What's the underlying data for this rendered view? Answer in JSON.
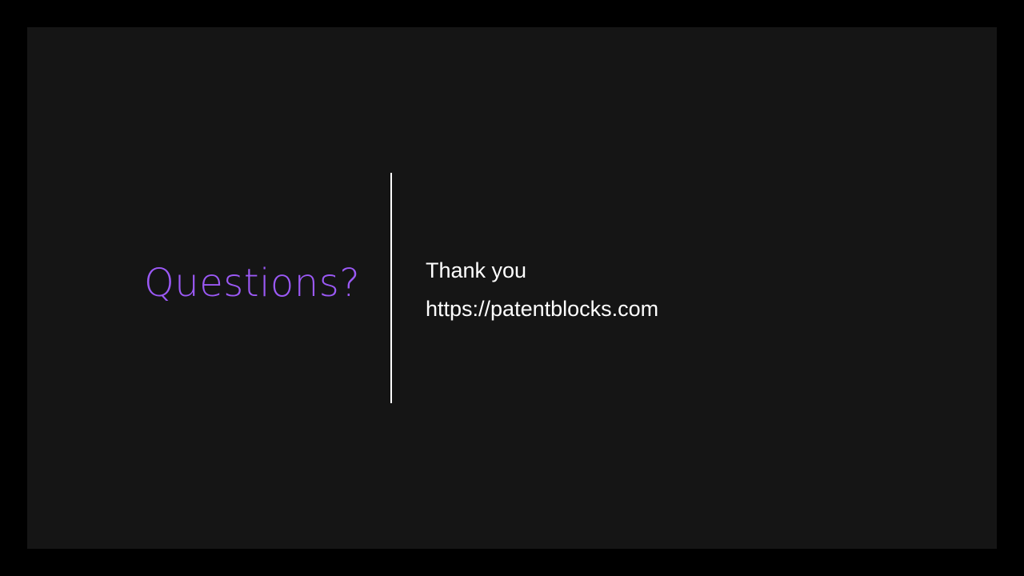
{
  "slide": {
    "heading": "Questions?",
    "lines": [
      "Thank you",
      "https://patentblocks.com"
    ]
  },
  "colors": {
    "outer_background": "#000000",
    "slide_background": "#151515",
    "heading": "#9B59F5",
    "text": "#FFFFFF",
    "divider": "#FFFFFF"
  }
}
